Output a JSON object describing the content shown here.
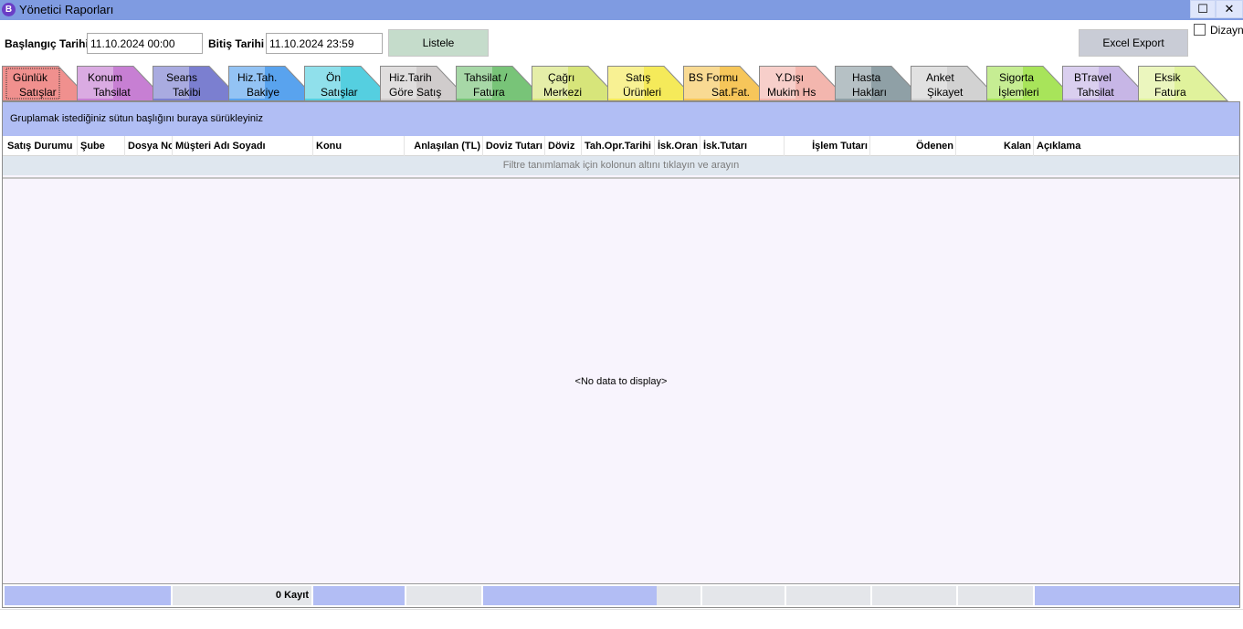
{
  "window": {
    "title": "Yönetici Raporları",
    "app_icon_letter": "B",
    "maximize_glyph": "☐",
    "close_glyph": "✕"
  },
  "filters": {
    "start_label": "Başlangıç Tarihi",
    "start_value": "11.10.2024 00:00",
    "end_label": "Bitiş Tarihi",
    "end_value": "11.10.2024 23:59",
    "list_button": "Listele",
    "export_button": "Excel Export",
    "design_checkbox": "Dizayn",
    "design_checked": false
  },
  "tabs": [
    {
      "line1": "Günlük",
      "line2": "Satışlar",
      "color": "#f0908e",
      "active": true
    },
    {
      "line1": "Konum",
      "line2": "Tahsilat",
      "color": "#c77fd3"
    },
    {
      "line1": "Seans",
      "line2": "Takibi",
      "color": "#7b7fd0"
    },
    {
      "line1": "Hiz.Tah.",
      "line2": "Bakiye",
      "color": "#59a3ee"
    },
    {
      "line1": "Ön",
      "line2": "Satışlar",
      "color": "#55cfe0"
    },
    {
      "line1": "Hiz.Tarih",
      "line2": "Göre Satış",
      "color": "#d0cccc"
    },
    {
      "line1": "Tahsilat /",
      "line2": "Fatura",
      "color": "#78c478"
    },
    {
      "line1": "Çağrı",
      "line2": "Merkezi",
      "color": "#d7e57a"
    },
    {
      "line1": "Satış",
      "line2": "Ürünleri",
      "color": "#f5ea5a"
    },
    {
      "line1": "BS Formu",
      "line2": "Sat.Fat.",
      "color": "#f6c65a"
    },
    {
      "line1": "Y.Dışı",
      "line2": "Mukim Hs",
      "color": "#f3b6ae"
    },
    {
      "line1": "Hasta",
      "line2": "Hakları",
      "color": "#8fa0a6"
    },
    {
      "line1": "Anket",
      "line2": "Şikayet",
      "color": "#d2d2d2"
    },
    {
      "line1": "Sigorta",
      "line2": "İşlemleri",
      "color": "#a8e45a"
    },
    {
      "line1": "BTravel",
      "line2": "Tahsilat",
      "color": "#c7b6e6"
    },
    {
      "line1": "Eksik",
      "line2": "Fatura",
      "color": "#e0f29c"
    }
  ],
  "grid": {
    "group_hint": "Gruplamak istediğiniz sütun başlığını buraya sürükleyiniz",
    "columns": [
      "Satış Durumu",
      "Şube",
      "Dosya No",
      "Müşteri Adı Soyadı",
      "Konu",
      "Anlaşılan (TL)",
      "Doviz Tutarı",
      "Döviz",
      "Tah.Opr.Tarihi",
      "İsk.Oran",
      "İsk.Tutarı",
      "İşlem Tutarı",
      "Ödenen",
      "Kalan",
      "Açıklama"
    ],
    "filter_hint": "Filtre tanımlamak için kolonun altını tıklayın ve arayın",
    "empty_text": "<No data to display>",
    "footer_count": "0 Kayıt"
  }
}
